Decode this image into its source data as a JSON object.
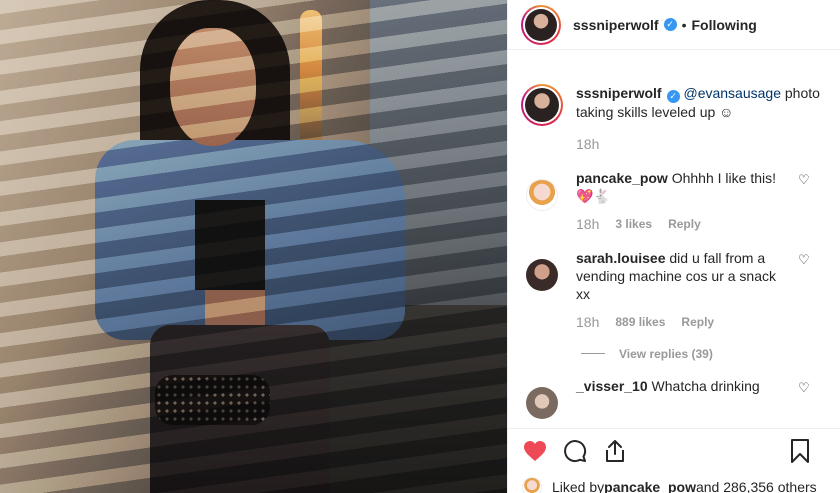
{
  "colors": {
    "accent_like": "#ed4956",
    "verified": "#3897f0",
    "mention": "#003569",
    "muted": "#999999",
    "text": "#262626"
  },
  "header": {
    "username": "sssniperwolf",
    "separator": "•",
    "follow_state": "Following"
  },
  "caption": {
    "username": "sssniperwolf",
    "mention": "@evansausage",
    "text": " photo taking skills leveled up ☺",
    "time": "18h"
  },
  "comments": [
    {
      "username": "pancake_pow",
      "text": "Ohhhh I like this! 💖🐇",
      "time": "18h",
      "likes": "3 likes",
      "reply": "Reply"
    },
    {
      "username": "sarah.louisee",
      "text": "did u fall from a vending machine cos ur a snack xx",
      "time": "18h",
      "likes": "889 likes",
      "reply": "Reply",
      "view_replies": "View replies (39)"
    },
    {
      "username": "_visser_10",
      "text": "Whatcha drinking"
    }
  ],
  "actions": {
    "like_icon": "heart-filled-icon",
    "comment_icon": "comment-bubble-icon",
    "share_icon": "share-icon",
    "save_icon": "bookmark-icon"
  },
  "liked_by": {
    "prefix": "Liked by ",
    "user": "pancake_pow",
    "suffix": " and 286,356 others"
  }
}
